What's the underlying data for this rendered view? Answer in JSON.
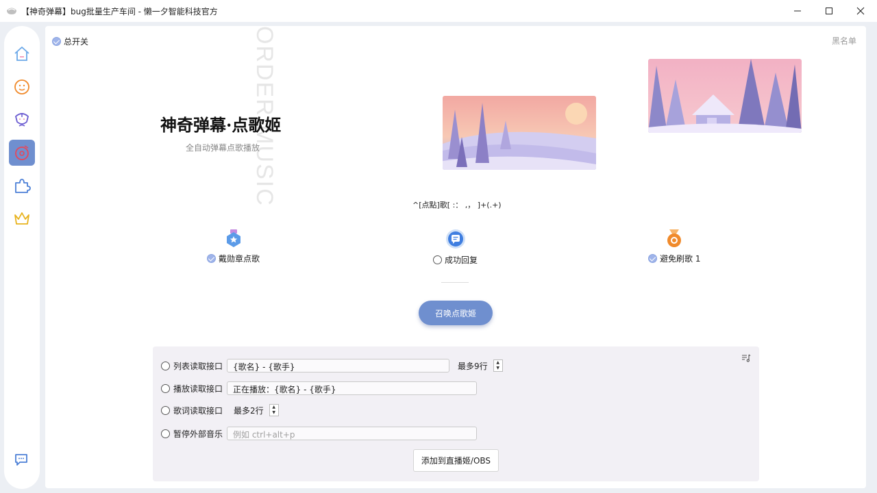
{
  "window": {
    "title": "【神奇弹幕】bug批量生产车间 - 懒一夕智能科技官方",
    "minimize_icon": "minimize-icon",
    "maximize_icon": "maximize-icon",
    "close_icon": "close-icon"
  },
  "sidebar": {
    "items": [
      {
        "icon": "home-icon",
        "active": false
      },
      {
        "icon": "chat-bubble-icon",
        "active": false
      },
      {
        "icon": "flower-face-icon",
        "active": false
      },
      {
        "icon": "music-disc-icon",
        "active": true
      },
      {
        "icon": "puzzle-icon",
        "active": false
      },
      {
        "icon": "crown-icon",
        "active": false
      }
    ],
    "bottom_icon": "feedback-chat-icon"
  },
  "header": {
    "master_switch_label": "总开关",
    "master_switch_checked": true,
    "blacklist_label": "黑名单"
  },
  "hero": {
    "watermark_text": "ORDER MUSIC",
    "title": "神奇弹幕·点歌姬",
    "subtitle": "全自动弹幕点歌播放"
  },
  "regex_pattern": "^[点點]歌[ :： ,， ]+(.+)",
  "options": [
    {
      "label": "戴勋章点歌",
      "checked": true,
      "icon": "medal-badge-icon"
    },
    {
      "label": "成功回复",
      "checked": false,
      "icon": "reply-message-icon"
    },
    {
      "label": "避免刷歌 1",
      "checked": true,
      "icon": "orange-medal-icon"
    }
  ],
  "summon_button_label": "召唤点歌姬",
  "music_panel": {
    "rows": [
      {
        "label": "列表读取接口",
        "checked": false,
        "input_value": "{歌名} - {歌手}",
        "extra": "最多9行"
      },
      {
        "label": "播放读取接口",
        "checked": false,
        "input_value": "正在播放：{歌名} - {歌手}"
      },
      {
        "label": "歌词读取接口",
        "checked": false,
        "extra": "最多2行"
      },
      {
        "label": "暂停外部音乐",
        "checked": false,
        "input_placeholder": "例如 ctrl+alt+p"
      }
    ],
    "add_button_label": "添加到直播姬/OBS",
    "corner_icon": "playlist-music-icon"
  },
  "colors": {
    "accent": "#6f8fcf",
    "frame_bg": "#eceff4",
    "music_box_bg": "#f2f0f5"
  }
}
